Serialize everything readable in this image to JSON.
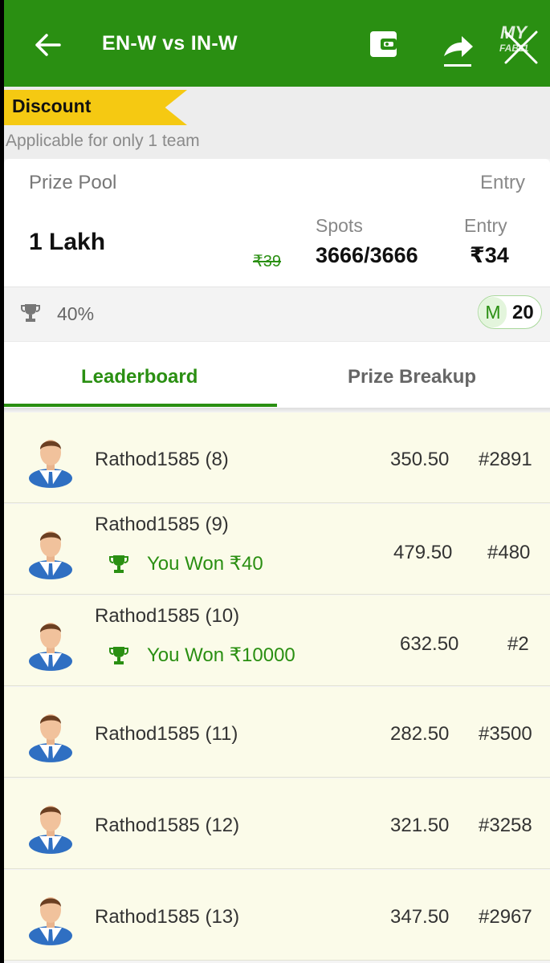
{
  "header": {
    "title": "EN-W vs IN-W",
    "logo_text": "MY",
    "logo_sub": "FAB11",
    "colors": {
      "header_bg": "#2a8f12",
      "accent": "#2a8f12",
      "discount": "#f5c912",
      "row_bg": "#fbfbe9"
    }
  },
  "discount": {
    "label": "Discount",
    "note": "Applicable for only 1 team"
  },
  "contest": {
    "prize_pool_label": "Prize Pool",
    "entry_header": "Entry",
    "prize_pool_value": "1 Lakh",
    "original_entry": "₹39",
    "spots_label": "Spots",
    "spots_value": "3666/3666",
    "entry_label": "Entry",
    "entry_value": "₹34",
    "winning_percent": "40%",
    "multi_label": "M",
    "multi_value": "20"
  },
  "tabs": [
    {
      "label": "Leaderboard",
      "active": true
    },
    {
      "label": "Prize Breakup",
      "active": false
    }
  ],
  "leaderboard": [
    {
      "name": "Rathod1585 (8)",
      "points": "350.50",
      "rank": "#2891",
      "won": ""
    },
    {
      "name": "Rathod1585 (9)",
      "points": "479.50",
      "rank": "#480",
      "won": "You Won ₹40"
    },
    {
      "name": "Rathod1585 (10)",
      "points": "632.50",
      "rank": "#2",
      "won": "You Won ₹10000"
    },
    {
      "name": "Rathod1585 (11)",
      "points": "282.50",
      "rank": "#3500",
      "won": ""
    },
    {
      "name": "Rathod1585 (12)",
      "points": "321.50",
      "rank": "#3258",
      "won": ""
    },
    {
      "name": "Rathod1585 (13)",
      "points": "347.50",
      "rank": "#2967",
      "won": ""
    }
  ]
}
